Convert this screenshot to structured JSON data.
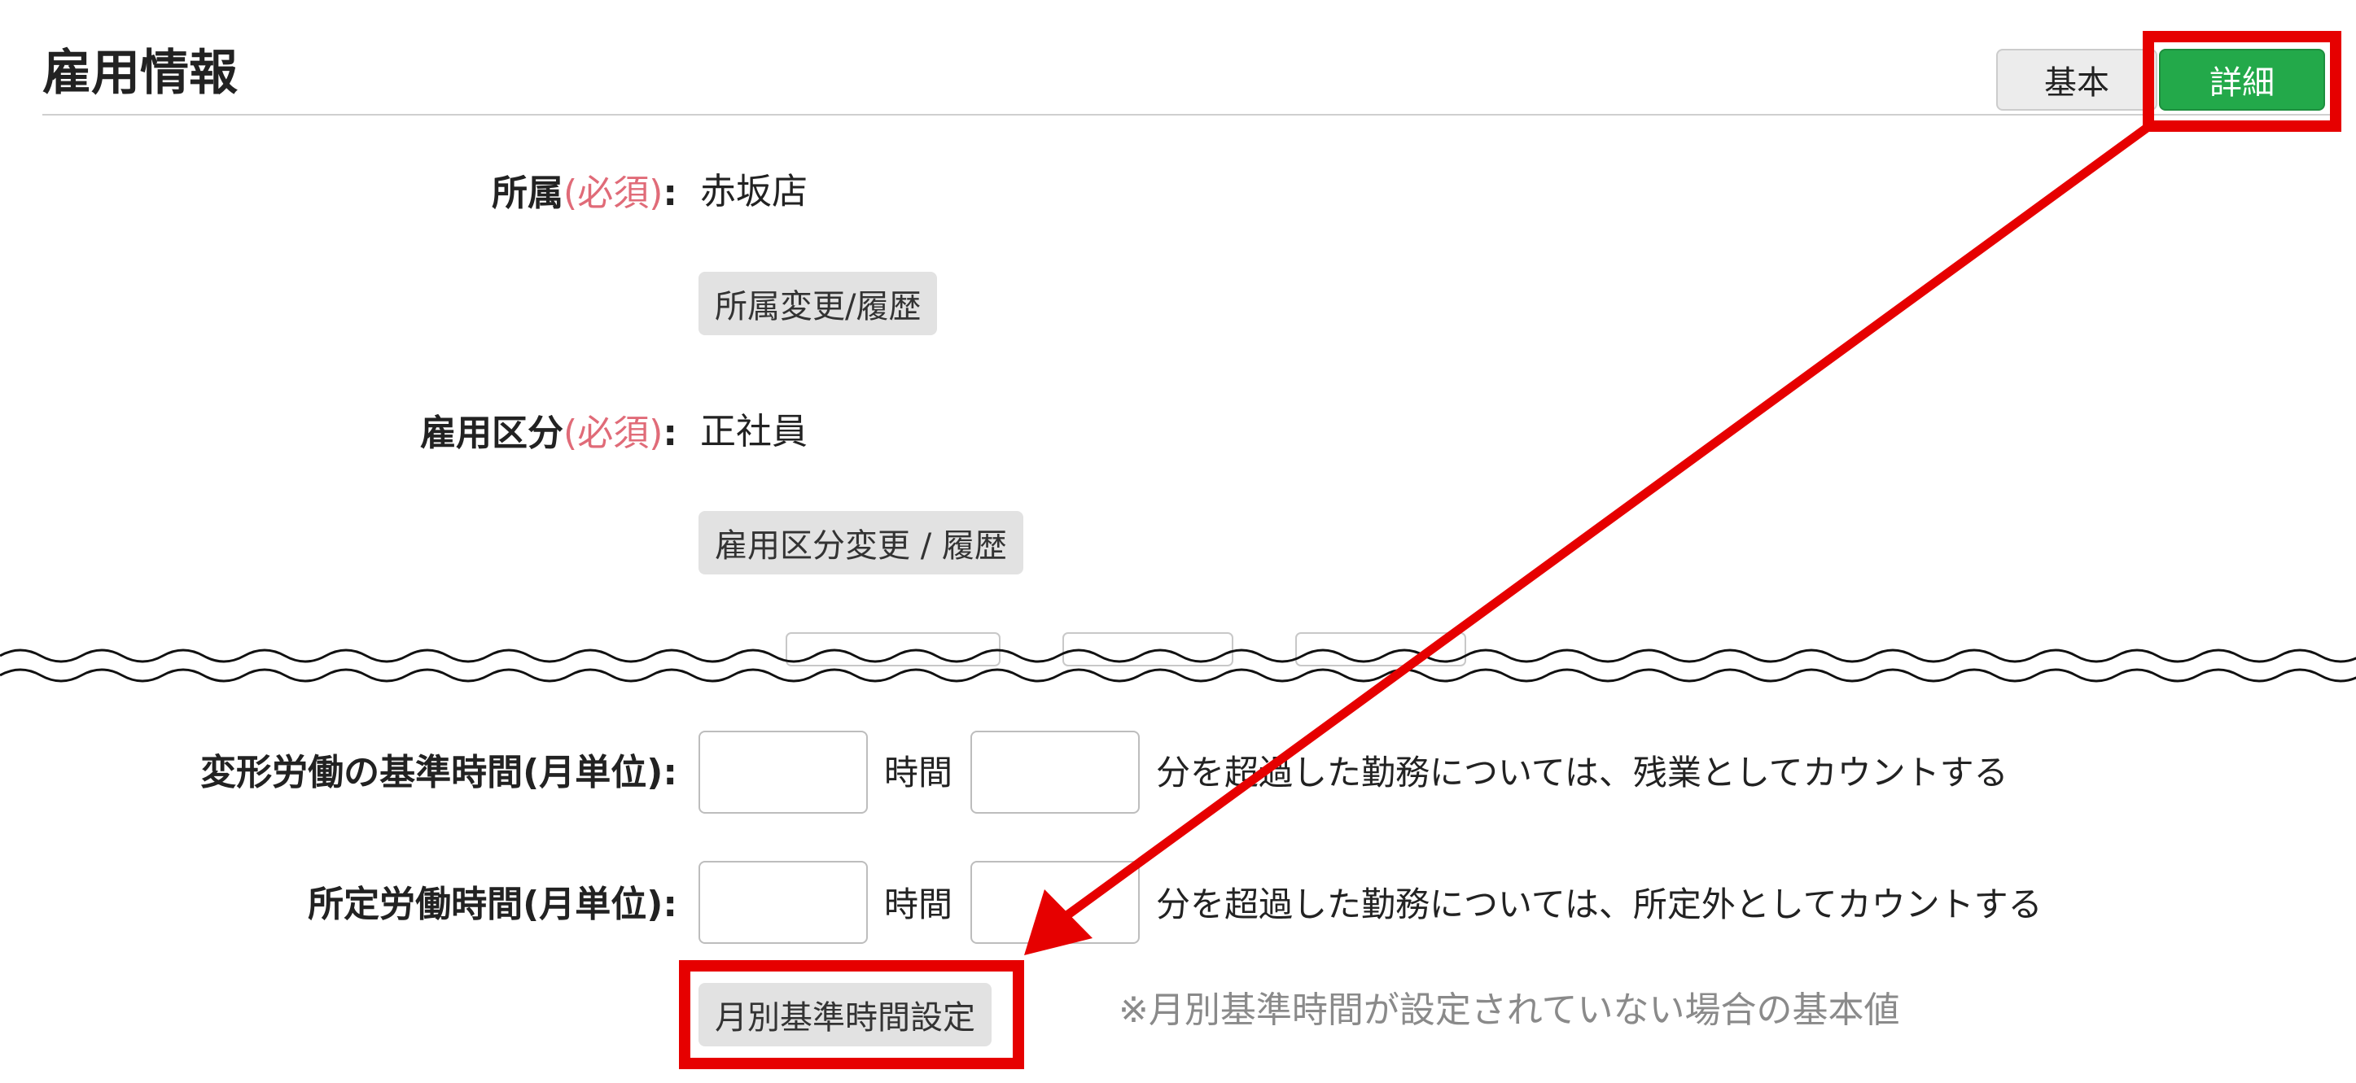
{
  "section": {
    "title": "雇用情報",
    "view_toggle": {
      "basic_label": "基本",
      "detail_label": "詳細"
    }
  },
  "fields": {
    "affiliation": {
      "label": "所属",
      "required": "(必須)",
      "colon": ":",
      "value": "赤坂店",
      "button": "所属変更/履歴"
    },
    "employment_type": {
      "label": "雇用区分",
      "required": "(必須)",
      "colon": ":",
      "value": "正社員",
      "button": "雇用区分変更 / 履歴"
    },
    "flex_standard_hours": {
      "label": "変形労働の基準時間(月単位):",
      "hours_value": "",
      "hours_unit": "時間",
      "minutes_value": "",
      "description": "分を超過した勤務については、残業としてカウントする"
    },
    "scheduled_hours": {
      "label": "所定労働時間(月単位):",
      "hours_value": "",
      "hours_unit": "時間",
      "minutes_value": "",
      "description": "分を超過した勤務については、所定外としてカウントする"
    },
    "monthly_setting": {
      "button": "月別基準時間設定",
      "note": "※月別基準時間が設定されていない場合の基本値"
    }
  },
  "colors": {
    "accent_green": "#23a94a",
    "highlight_red": "#e60000",
    "required_pink": "#e06b78"
  }
}
